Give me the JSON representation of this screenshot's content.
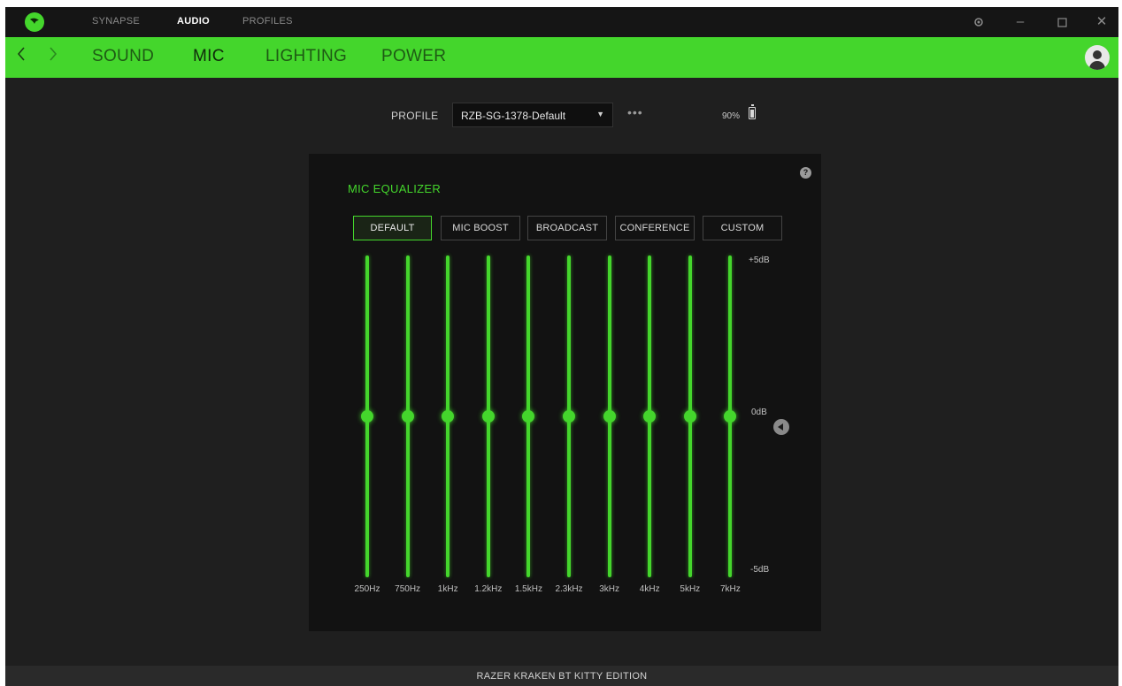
{
  "titlebar": {
    "tabs": [
      {
        "label": "SYNAPSE",
        "active": false
      },
      {
        "label": "AUDIO",
        "active": true
      },
      {
        "label": "PROFILES",
        "active": false
      }
    ],
    "controls": {
      "settings_icon": "gear-icon",
      "minimize_icon": "minimize-icon",
      "maximize_icon": "maximize-icon",
      "close_icon": "close-icon"
    }
  },
  "subnav": {
    "back_icon": "chevron-left-icon",
    "forward_icon": "chevron-right-icon",
    "tabs": [
      {
        "label": "SOUND",
        "active": false
      },
      {
        "label": "MIC",
        "active": true
      },
      {
        "label": "LIGHTING",
        "active": false
      },
      {
        "label": "POWER",
        "active": false
      }
    ],
    "avatar_icon": "user-avatar-icon"
  },
  "profile": {
    "label": "PROFILE",
    "selected": "RZB-SG-1378-Default",
    "more": "•••",
    "battery_percent": "90%"
  },
  "equalizer": {
    "title": "MIC EQUALIZER",
    "presets": [
      {
        "label": "DEFAULT",
        "active": true
      },
      {
        "label": "MIC BOOST",
        "active": false
      },
      {
        "label": "BROADCAST",
        "active": false
      },
      {
        "label": "CONFERENCE",
        "active": false
      },
      {
        "label": "CUSTOM",
        "active": false
      }
    ],
    "bands": [
      {
        "freq": "250Hz",
        "gain_db": 0
      },
      {
        "freq": "750Hz",
        "gain_db": 0
      },
      {
        "freq": "1kHz",
        "gain_db": 0
      },
      {
        "freq": "1.2kHz",
        "gain_db": 0
      },
      {
        "freq": "1.5kHz",
        "gain_db": 0
      },
      {
        "freq": "2.3kHz",
        "gain_db": 0
      },
      {
        "freq": "3kHz",
        "gain_db": 0
      },
      {
        "freq": "4kHz",
        "gain_db": 0
      },
      {
        "freq": "5kHz",
        "gain_db": 0
      },
      {
        "freq": "7kHz",
        "gain_db": 0
      }
    ],
    "db_max_label": "+5dB",
    "db_zero_label": "0dB",
    "db_min_label": "-5dB",
    "db_range": [
      -5,
      5
    ]
  },
  "status": {
    "device_name": "RAZER KRAKEN BT KITTY EDITION"
  },
  "colors": {
    "accent": "#44d62c",
    "background": "#1f1f1f",
    "panel": "#121212"
  }
}
